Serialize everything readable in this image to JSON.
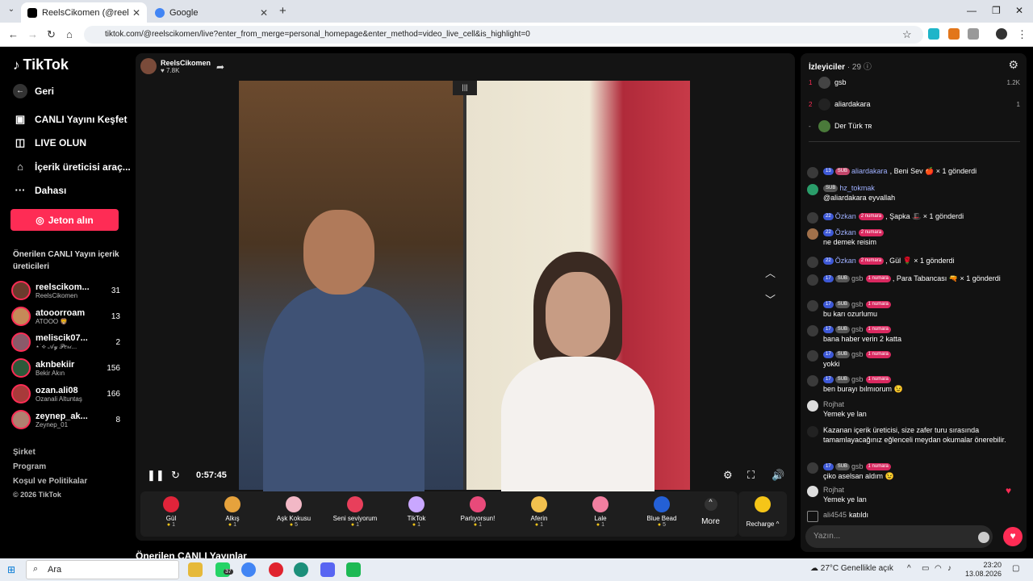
{
  "browser": {
    "tabs": [
      {
        "title": "ReelsCikomen (@reelscikomen)",
        "active": true
      },
      {
        "title": "Google",
        "active": false
      }
    ],
    "url": "tiktok.com/@reelscikomen/live?enter_from_merge=personal_homepage&enter_method=video_live_cell&is_highlight=0"
  },
  "sidebar": {
    "logo": "TikTok",
    "back": "Geri",
    "nav": [
      {
        "label": "CANLI Yayını Keşfet",
        "icon": "live-explore-icon"
      },
      {
        "label": "LIVE OLUN",
        "icon": "camera-icon"
      },
      {
        "label": "İçerik üreticisi araç...",
        "icon": "creator-tools-icon"
      },
      {
        "label": "Dahası",
        "icon": "more-dots-icon"
      }
    ],
    "coins_button": "Jeton alın",
    "recommended_title": "Önerilen CANLI Yayın içerik üreticileri",
    "creators": [
      {
        "name": "reelscikom...",
        "sub": "ReelsCikomen",
        "count": "31"
      },
      {
        "name": "atooorroam",
        "sub": "ATOOO 🦁",
        "count": "13"
      },
      {
        "name": "meliscik07...",
        "sub": "⋆˙⟡ 𝒜𝓎 𝒫𝑒𝓇𝒾...",
        "count": "2"
      },
      {
        "name": "aknbekiir",
        "sub": "Bekir Akın",
        "count": "156"
      },
      {
        "name": "ozan.ali08",
        "sub": "Ozanali Altuntaş",
        "count": "166"
      },
      {
        "name": "zeynep_ak...",
        "sub": "Zeynep_01",
        "count": "8"
      }
    ],
    "footer": [
      "Şirket",
      "Program",
      "Koşul ve Politikalar",
      "© 2026 TikTok"
    ]
  },
  "player": {
    "streamer_name": "ReelsCikomen",
    "streamer_likes": "7.8K",
    "elapsed": "0:57:45",
    "gifts": [
      {
        "name": "Gül",
        "price": "1",
        "color": "#e0243a"
      },
      {
        "name": "Alkış",
        "price": "1",
        "color": "#e6a23c"
      },
      {
        "name": "Aşk Kokusu",
        "price": "5",
        "color": "#f2b8c6"
      },
      {
        "name": "Seni seviyorum",
        "price": "1",
        "color": "#e83f5b"
      },
      {
        "name": "TikTok",
        "price": "1",
        "color": "#c9a7ff"
      },
      {
        "name": "Parlıyorsun!",
        "price": "1",
        "color": "#e84a7a"
      },
      {
        "name": "Aferin",
        "price": "1",
        "color": "#f2c14e"
      },
      {
        "name": "Lale",
        "price": "1",
        "color": "#f17fa0"
      },
      {
        "name": "Blue Bead",
        "price": "5",
        "color": "#2460d6"
      }
    ],
    "more_label": "More",
    "recharge_label": "Recharge ^"
  },
  "below_player": "Önerilen CANLI Yayınlar",
  "chat": {
    "viewers_label": "İzleyiciler",
    "viewers_count": "· 29",
    "top_viewers": [
      {
        "rank": "1",
        "name": "gsb",
        "score": "1.2K"
      },
      {
        "rank": "2",
        "name": "aliardakara",
        "score": "1"
      },
      {
        "rank": "-",
        "name": "Der Türk ᴛʀ",
        "score": ""
      }
    ],
    "messages": [
      {
        "lv": "13",
        "sub": "SUB",
        "num": "",
        "user": "aliardakara",
        "text": ", Beni Sev 🍎 × 1 gönderdi",
        "gift": true
      },
      {
        "lv": "",
        "sub": "SUB",
        "num": "",
        "user": "hz_tokmak",
        "text": "@aliardakara eyvallah",
        "gift": false
      },
      {
        "lv": "22",
        "sub": "",
        "num": "2 numara",
        "user": "Özkan",
        "text": ", Şapka 🎩 × 1 gönderdi",
        "gift": true
      },
      {
        "lv": "22",
        "sub": "",
        "num": "2 numara",
        "user": "Özkan",
        "text": "ne demek reisim",
        "gift": false
      },
      {
        "lv": "22",
        "sub": "",
        "num": "2 numara",
        "user": "Özkan",
        "text": ", Gül 🌹 × 1 gönderdi",
        "gift": true
      },
      {
        "lv": "17",
        "sub": "SUB",
        "num": "1 numara",
        "user": "gsb",
        "text": ", Para Tabancası 🔫 × 1 gönderdi",
        "gift": true
      },
      {
        "lv": "17",
        "sub": "SUB",
        "num": "1 numara",
        "user": "gsb",
        "text": "bu karı ozurlumu",
        "gift": false
      },
      {
        "lv": "17",
        "sub": "SUB",
        "num": "1 numara",
        "user": "gsb",
        "text": "bana haber verin 2 katta",
        "gift": false
      },
      {
        "lv": "17",
        "sub": "SUB",
        "num": "1 numara",
        "user": "gsb",
        "text": "yokki",
        "gift": false
      },
      {
        "lv": "17",
        "sub": "SUB",
        "num": "1 numara",
        "user": "gsb",
        "text": "ben burayı bılmıorum 😉",
        "gift": false
      },
      {
        "lv": "",
        "sub": "",
        "num": "",
        "user": "Rojhat",
        "text": "Yemek ye lan",
        "gift": false
      },
      {
        "lv": "",
        "sub": "",
        "num": "",
        "user": "",
        "text": "Kazanan içerik üreticisi, size zafer turu sırasında tamamlayacağınız eğlenceli meydan okumalar önerebilir.",
        "gift": false
      },
      {
        "lv": "17",
        "sub": "SUB",
        "num": "1 numara",
        "user": "gsb",
        "text": "çiko aselsan aldım 😉",
        "gift": false
      },
      {
        "lv": "",
        "sub": "",
        "num": "",
        "user": "Rojhat",
        "text": "Yemek ye lan",
        "gift": false
      },
      {
        "lv": "",
        "sub": "",
        "num": "",
        "user": "ali4545",
        "text": "katıldı",
        "gift": false
      }
    ],
    "input_placeholder": "Yazın..."
  },
  "taskbar": {
    "search": "Ara",
    "weather": "27°C  Genellikle açık",
    "time": "23:20",
    "date": "13.08.2026",
    "badge": "37"
  }
}
